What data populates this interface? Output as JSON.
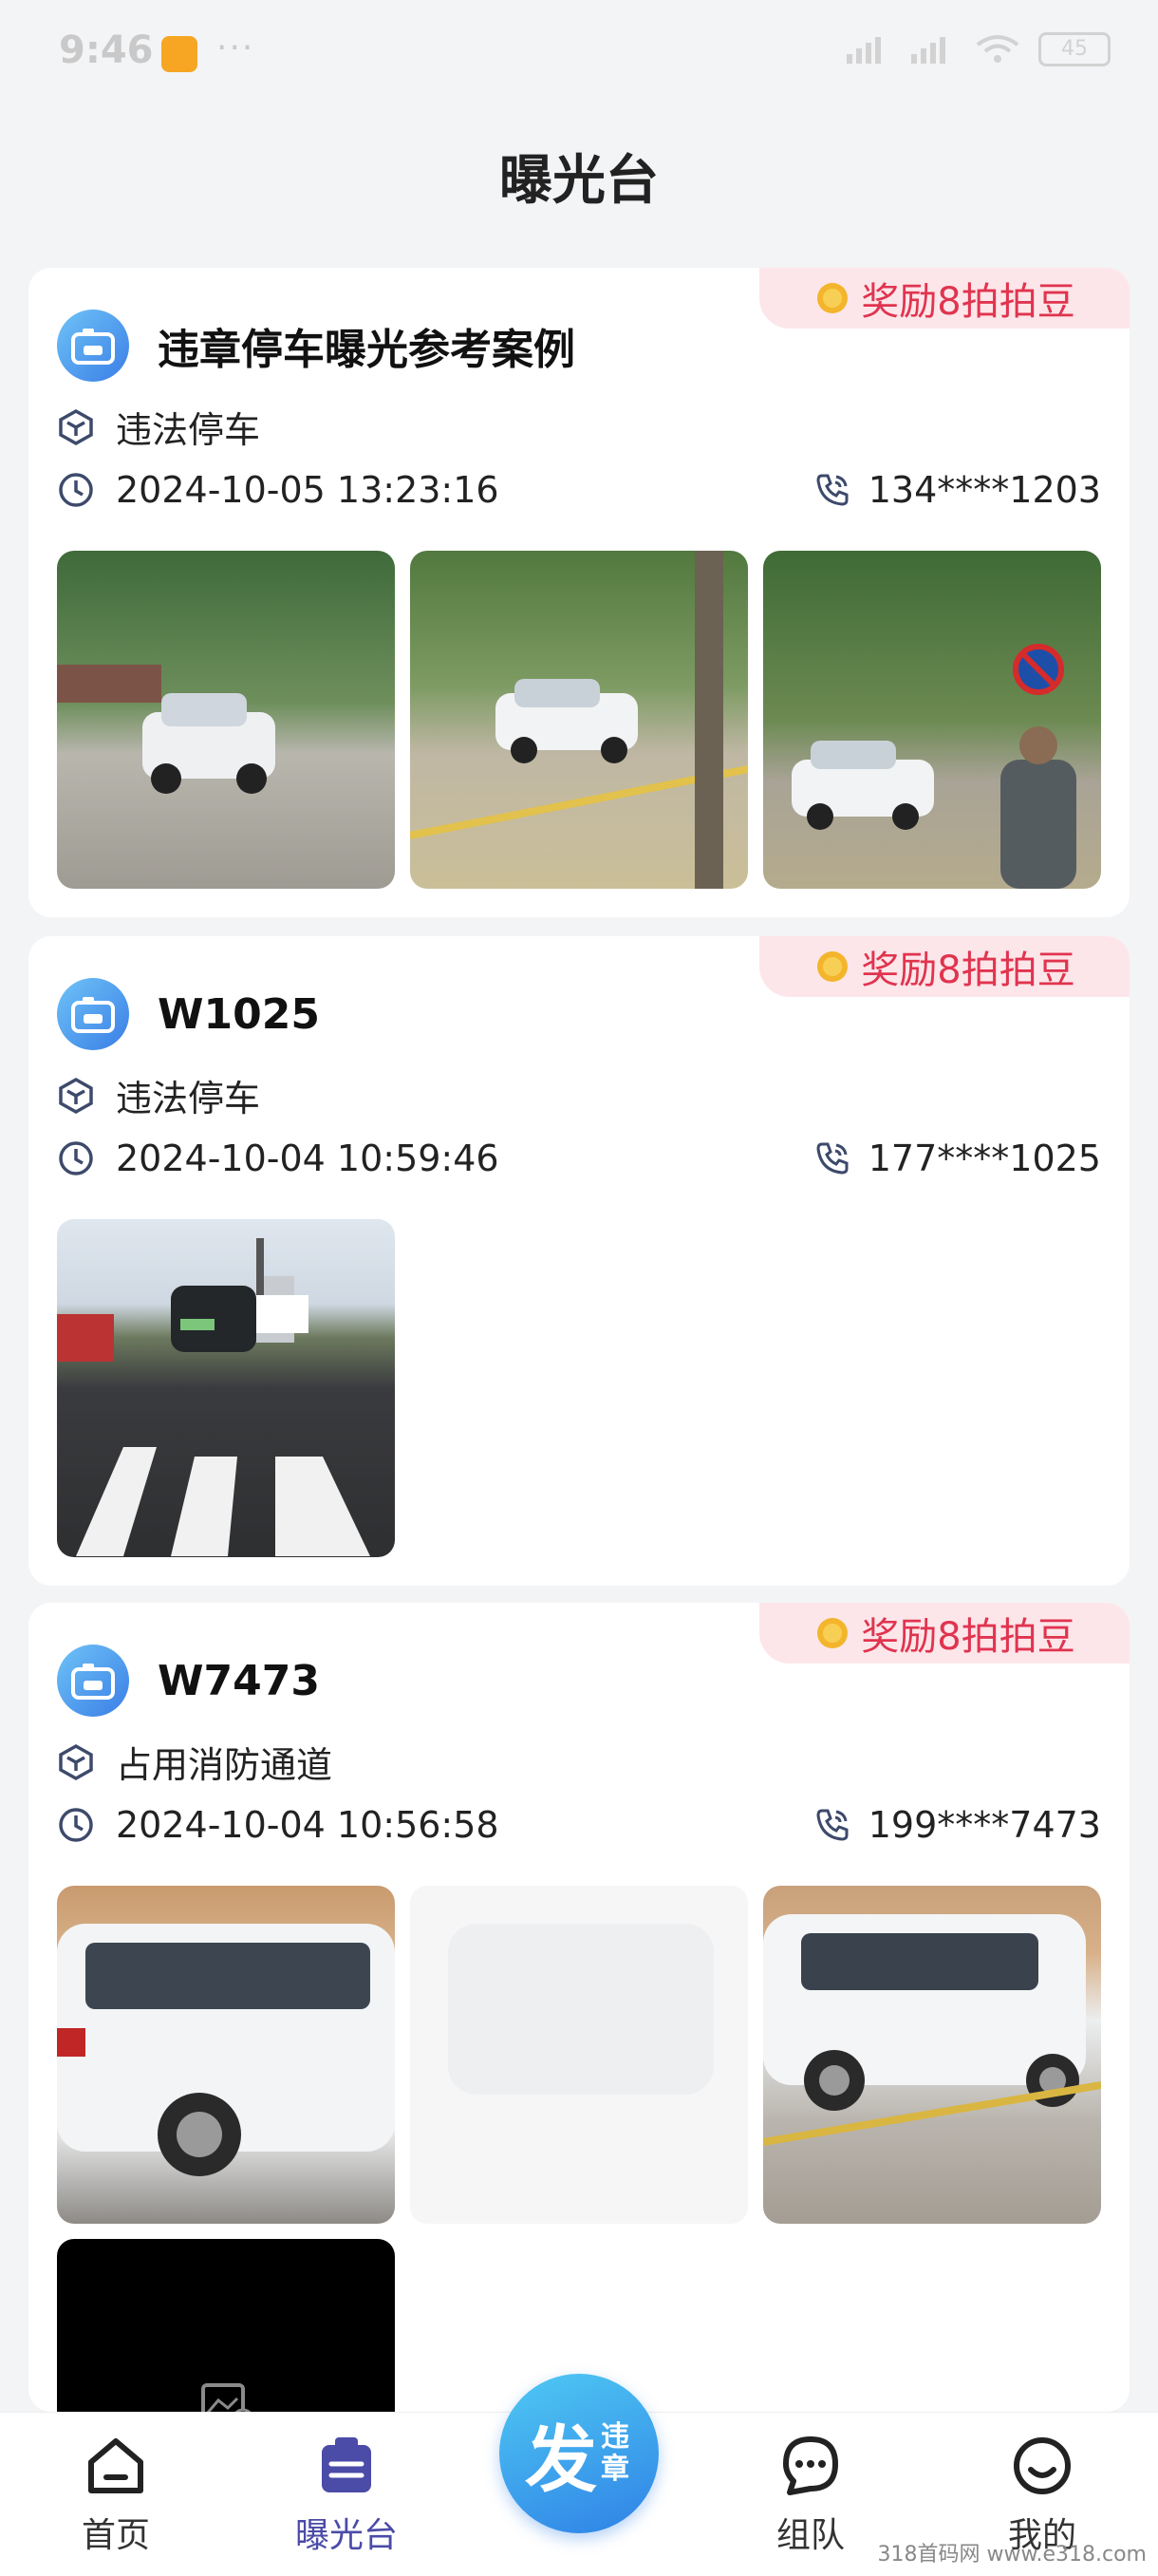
{
  "status_bar": {
    "time": "9:46",
    "dots": "···",
    "battery": "45"
  },
  "page": {
    "title": "曝光台"
  },
  "reward_label": "奖励8拍拍豆",
  "cards": [
    {
      "title": "违章停车曝光参考案例",
      "category": "违法停车",
      "datetime": "2024-10-05 13:23:16",
      "phone": "134****1203",
      "photos": 3
    },
    {
      "title": "W1025",
      "category": "违法停车",
      "datetime": "2024-10-04 10:59:46",
      "phone": "177****1025",
      "photos": 1
    },
    {
      "title": "W7473",
      "category": "占用消防通道",
      "datetime": "2024-10-04 10:56:58",
      "phone": "199****7473",
      "photos": 4
    }
  ],
  "tabbar": {
    "home": "首页",
    "exposure": "曝光台",
    "fab_big": "发",
    "fab_small": "违章",
    "team": "组队",
    "mine": "我的"
  },
  "watermark": "318首码网 www.e318.com",
  "colors": {
    "accent": "#4b4ba8",
    "reward_text": "#e0344f",
    "reward_bg": "#fde6ea",
    "fab": "#2f82e6"
  }
}
